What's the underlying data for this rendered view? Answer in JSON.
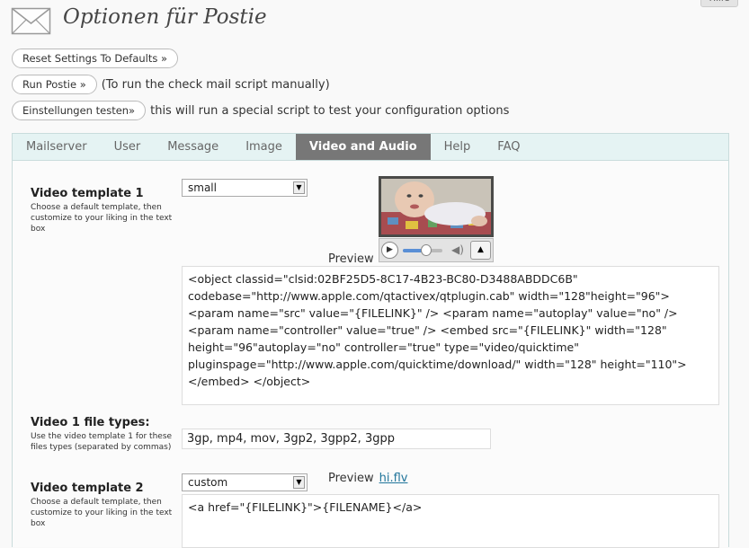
{
  "header": {
    "title": "Optionen für Postie",
    "help_tab": "Hilfe"
  },
  "buttons": {
    "reset": "Reset Settings To Defaults »",
    "run": "Run Postie »",
    "run_note": "(To run the check mail script manually)",
    "test": "Einstellungen testen»",
    "test_note": "this will run a special script to test your configuration options"
  },
  "tabs": [
    {
      "label": "Mailserver",
      "active": false
    },
    {
      "label": "User",
      "active": false
    },
    {
      "label": "Message",
      "active": false
    },
    {
      "label": "Image",
      "active": false
    },
    {
      "label": "Video and Audio",
      "active": true
    },
    {
      "label": "Help",
      "active": false
    },
    {
      "label": "FAQ",
      "active": false
    }
  ],
  "video1": {
    "label": "Video template 1",
    "desc": "Choose a default template, then customize to your liking in the text box",
    "selected": "small",
    "preview_label": "Preview",
    "player_volume": 0.6,
    "template": "<object classid=\"clsid:02BF25D5-8C17-4B23-BC80-D3488ABDDC6B\" codebase=\"http://www.apple.com/qtactivex/qtplugin.cab\" width=\"128\"height=\"96\">\n<param name=\"src\" value=\"{FILELINK}\" /> <param name=\"autoplay\" value=\"no\" />\n<param name=\"controller\" value=\"true\" /> <embed src=\"{FILELINK}\" width=\"128\"\nheight=\"96\"autoplay=\"no\" controller=\"true\" type=\"video/quicktime\"\npluginspage=\"http://www.apple.com/quicktime/download/\" width=\"128\" height=\"110\">\n</embed> </object>"
  },
  "video1_types": {
    "label": "Video 1 file types:",
    "desc": "Use the video template 1 for these files types (separated by commas)",
    "value": "3gp, mp4, mov, 3gp2, 3gpp2, 3gpp"
  },
  "video2": {
    "label": "Video template 2",
    "desc": "Choose a default template, then customize to your liking in the text box",
    "selected": "custom",
    "preview_label": "Preview",
    "preview_link": "hi.flv",
    "template": "<a href=\"{FILELINK}\">{FILENAME}</a>"
  },
  "colors": {
    "tab_active_bg": "#777777",
    "tab_bar_bg": "#e5f3f3",
    "link": "#21759b"
  }
}
